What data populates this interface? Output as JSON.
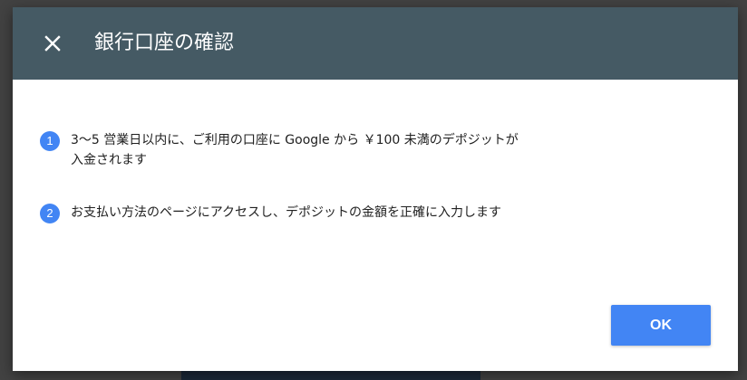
{
  "dialog": {
    "title": "銀行口座の確認",
    "close_icon": "close-icon",
    "steps": [
      {
        "number": "1",
        "text": "3〜5 営業日以内に、ご利用の口座に Google から ￥100 未満のデポジットが入金されます"
      },
      {
        "number": "2",
        "text": "お支払い方法のページにアクセスし、デポジットの金額を正確に入力します"
      }
    ],
    "ok_label": "OK"
  },
  "colors": {
    "header_bg": "#455a64",
    "accent": "#4285f4",
    "backdrop": "#424242"
  }
}
